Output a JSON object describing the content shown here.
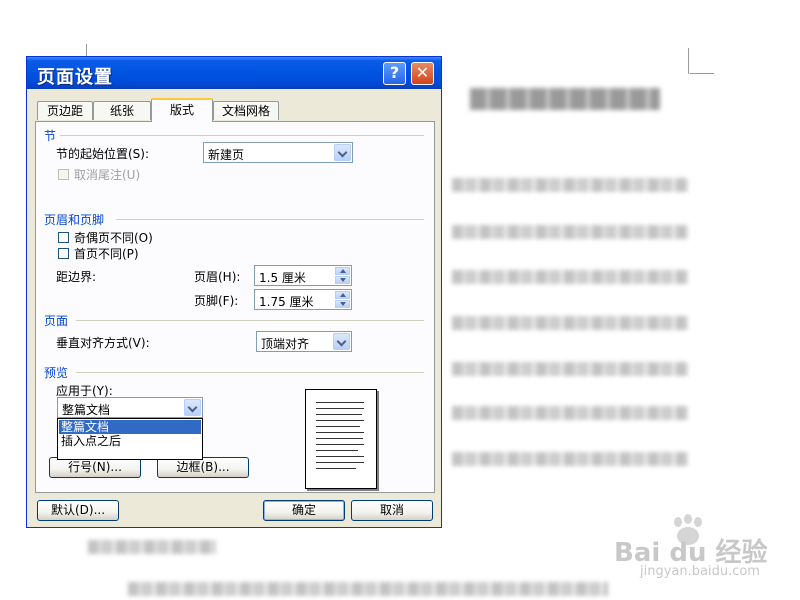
{
  "dialog": {
    "title": "页面设置",
    "help_glyph": "?",
    "close_glyph": "✕"
  },
  "tabs": [
    {
      "label": "页边距",
      "active": false
    },
    {
      "label": "纸张",
      "active": false
    },
    {
      "label": "版式",
      "active": true
    },
    {
      "label": "文档网格",
      "active": false
    }
  ],
  "section": {
    "title": "节",
    "start_label": "节的起始位置(S):",
    "start_value": "新建页",
    "suppress_endnotes_label": "取消尾注(U)"
  },
  "header_footer": {
    "title": "页眉和页脚",
    "odd_even_label": "奇偶页不同(O)",
    "first_page_label": "首页不同(P)",
    "from_edge_label": "距边界:",
    "header_label": "页眉(H):",
    "header_value": "1.5 厘米",
    "footer_label": "页脚(F):",
    "footer_value": "1.75 厘米"
  },
  "page": {
    "title": "页面",
    "valign_label": "垂直对齐方式(V):",
    "valign_value": "顶端对齐"
  },
  "preview": {
    "title": "预览",
    "apply_to_label": "应用于(Y):",
    "apply_to_value": "整篇文档",
    "apply_to_options": [
      "整篇文档",
      "插入点之后"
    ],
    "line_numbers_button": "行号(N)...",
    "borders_button": "边框(B)..."
  },
  "footer": {
    "default_button": "默认(D)...",
    "ok_button": "确定",
    "cancel_button": "取消"
  },
  "watermark": {
    "brand": "Bai du 经验",
    "url": "jingyan.baidu.com"
  },
  "colors": {
    "title_bar": "#0053e1",
    "group_title": "#0046d5",
    "selection": "#316ac5",
    "dialog_bg": "#ece9d8"
  },
  "icons": {
    "help": "help-icon",
    "close": "close-icon",
    "dropdown": "chevron-down-icon",
    "spin": "spin-arrows-icon"
  }
}
